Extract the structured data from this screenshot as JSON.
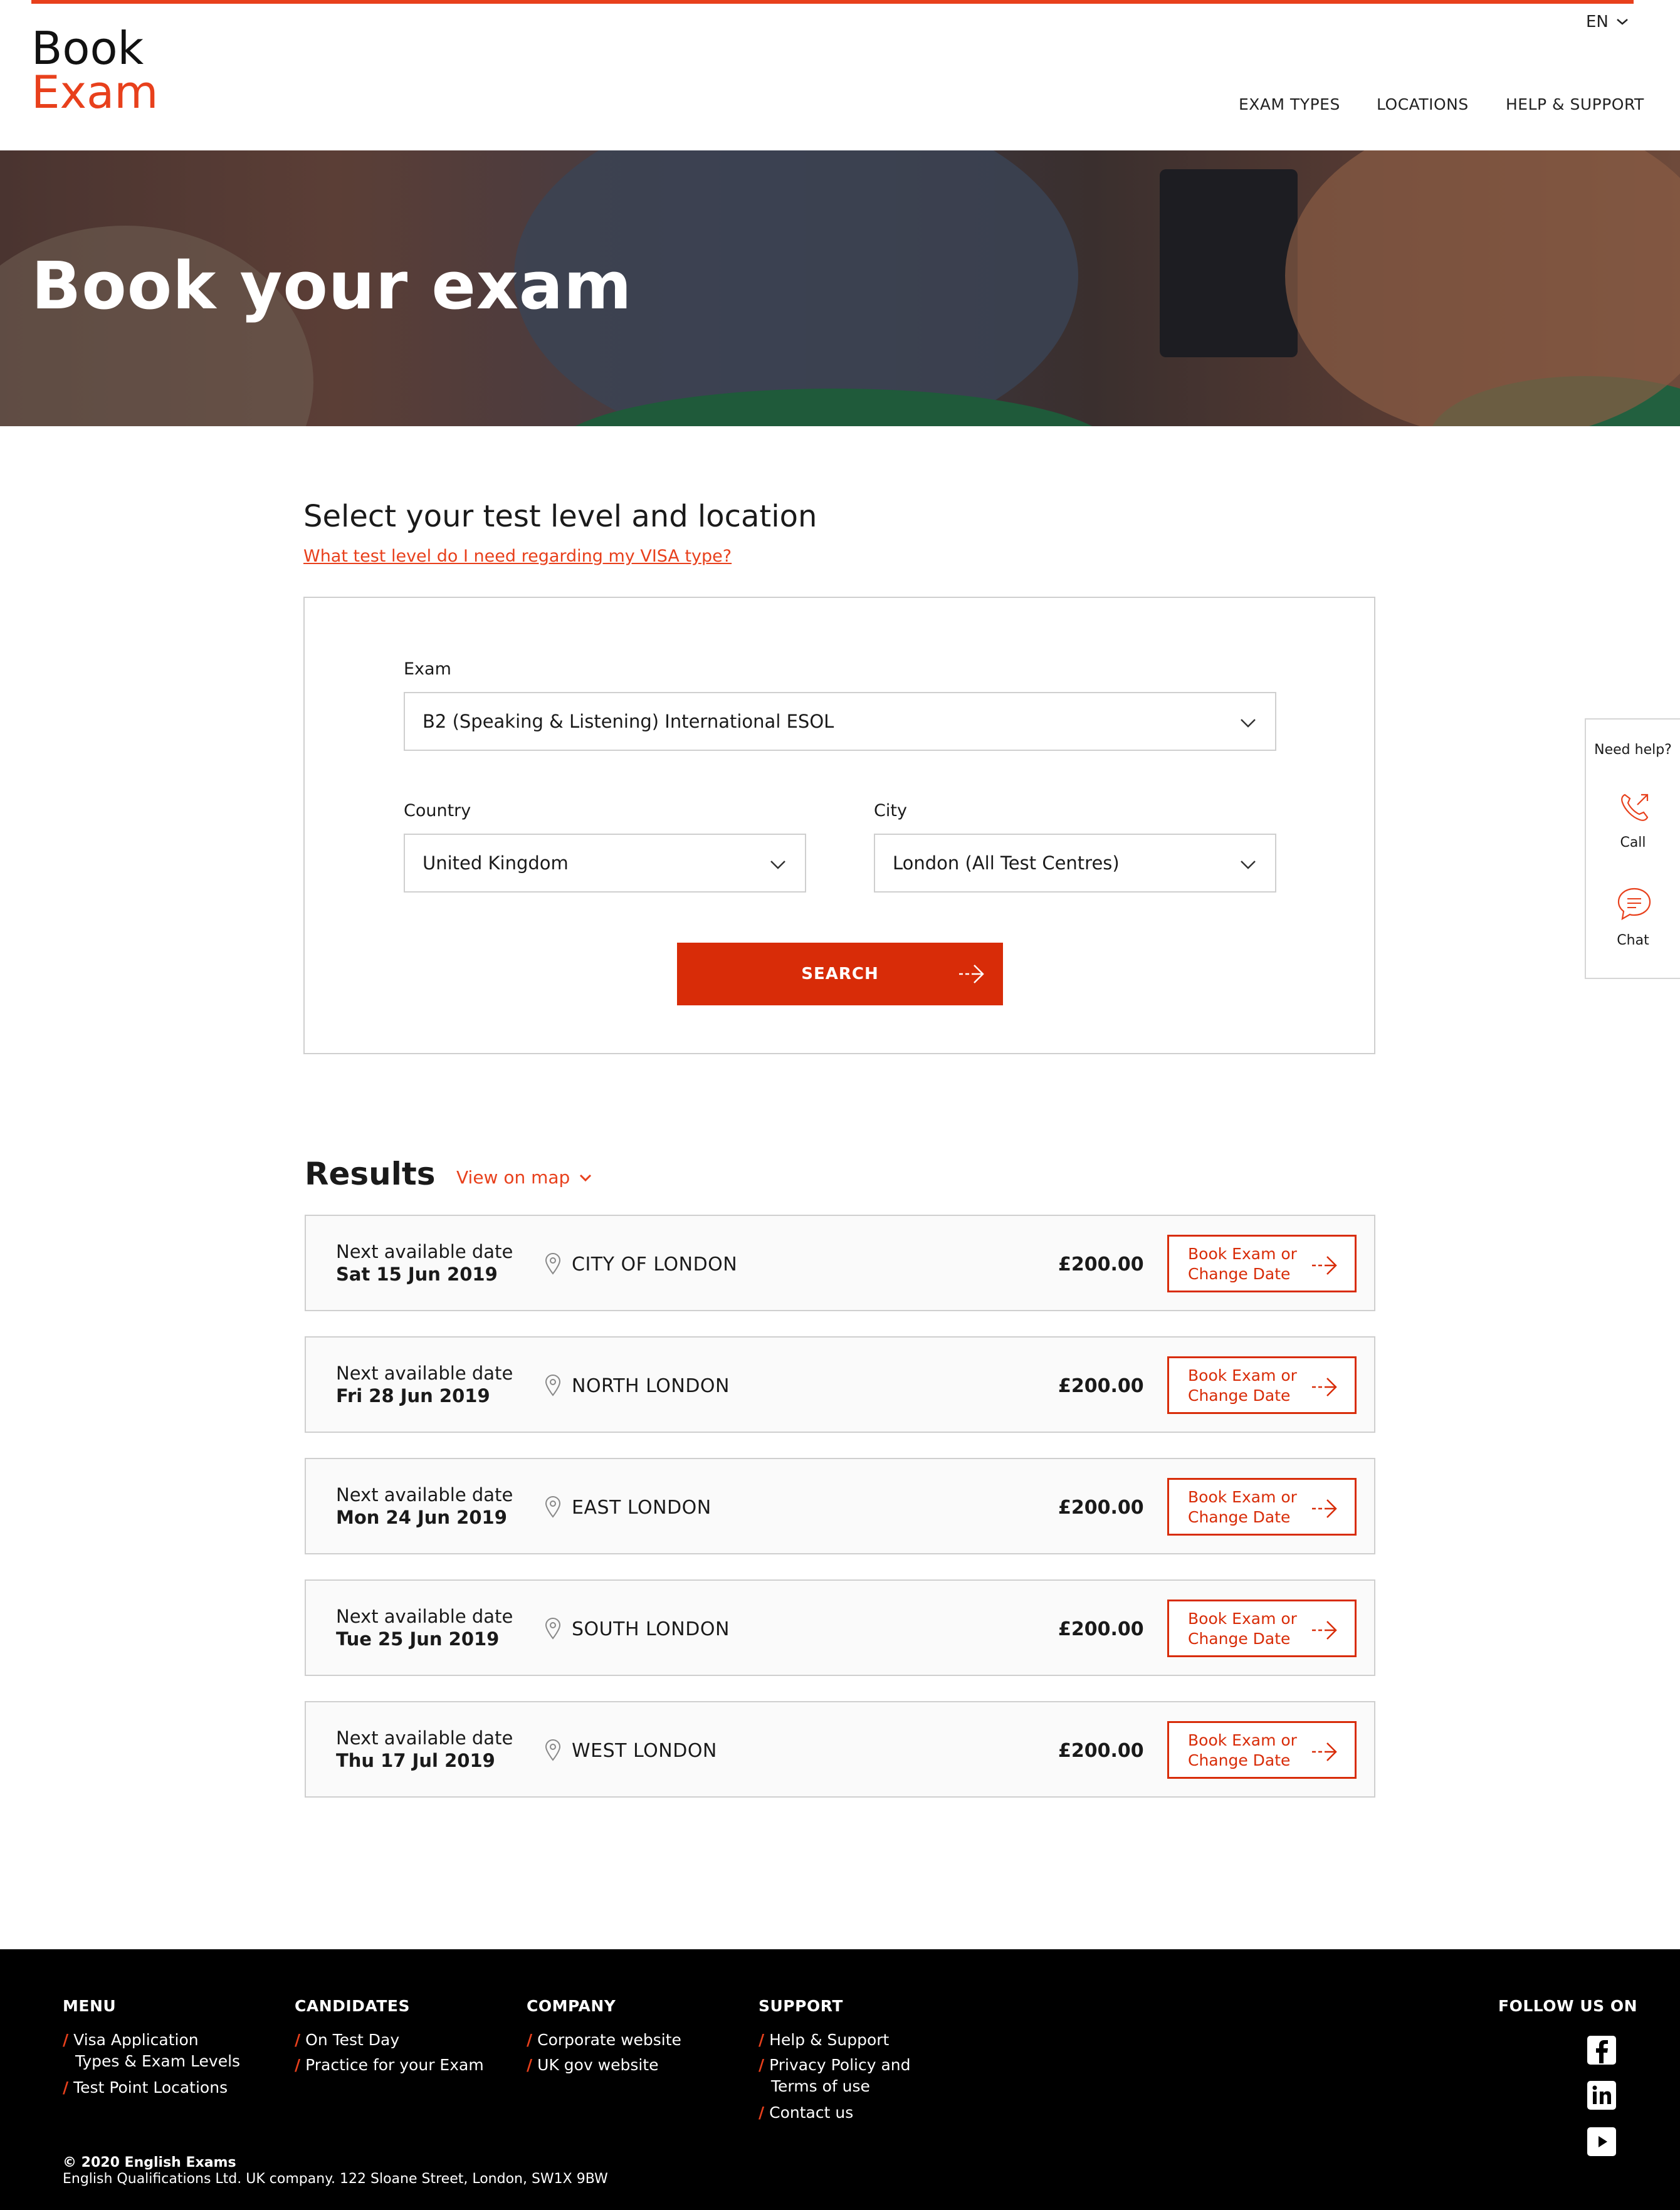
{
  "colors": {
    "accent": "#e8401c",
    "button": "#d82c08",
    "footer_bg": "#000000"
  },
  "header": {
    "logo_line1": "Book",
    "logo_line2": "Exam",
    "language": "EN",
    "nav": [
      "EXAM TYPES",
      "LOCATIONS",
      "HELP & SUPPORT"
    ]
  },
  "hero": {
    "title": "Book your exam"
  },
  "form": {
    "section_title": "Select your test level and location",
    "visa_link": "What test level do I need regarding my VISA type?",
    "exam_label": "Exam",
    "exam_value": "B2 (Speaking & Listening) International ESOL",
    "country_label": "Country",
    "country_value": "United Kingdom",
    "city_label": "City",
    "city_value": "London (All Test Centres)",
    "search_label": "SEARCH"
  },
  "results": {
    "title": "Results",
    "map_link": "View on map",
    "next_label": "Next available date",
    "book_line1": "Book Exam or",
    "book_line2": "Change Date",
    "rows": [
      {
        "date": "Sat 15 Jun 2019",
        "location": "CITY OF LONDON",
        "price": "£200.00"
      },
      {
        "date": "Fri 28 Jun 2019",
        "location": "NORTH LONDON",
        "price": "£200.00"
      },
      {
        "date": "Mon 24 Jun 2019",
        "location": "EAST LONDON",
        "price": "£200.00"
      },
      {
        "date": "Tue 25 Jun 2019",
        "location": "SOUTH LONDON",
        "price": "£200.00"
      },
      {
        "date": "Thu 17 Jul 2019",
        "location": "WEST LONDON",
        "price": "£200.00"
      }
    ]
  },
  "help_widget": {
    "title": "Need help?",
    "call": "Call",
    "chat": "Chat"
  },
  "footer": {
    "menu": {
      "heading": "MENU",
      "links": [
        "Visa Application",
        "Types & Exam Levels",
        "Test Point Locations"
      ]
    },
    "candidates": {
      "heading": "CANDIDATES",
      "links": [
        "On Test Day",
        "Practice for your Exam"
      ]
    },
    "company": {
      "heading": "COMPANY",
      "links": [
        "Corporate website",
        "UK gov website"
      ]
    },
    "support": {
      "heading": "SUPPORT",
      "links": [
        "Help & Support",
        "Privacy Policy and",
        "Terms of use",
        "Contact us"
      ]
    },
    "follow": "FOLLOW US ON",
    "social_icons": [
      "facebook-icon",
      "linkedin-icon",
      "youtube-icon"
    ],
    "copyright": "© 2020 English Exams",
    "address": "English Qualifications Ltd. UK company. 122 Sloane Street, London, SW1X 9BW"
  }
}
